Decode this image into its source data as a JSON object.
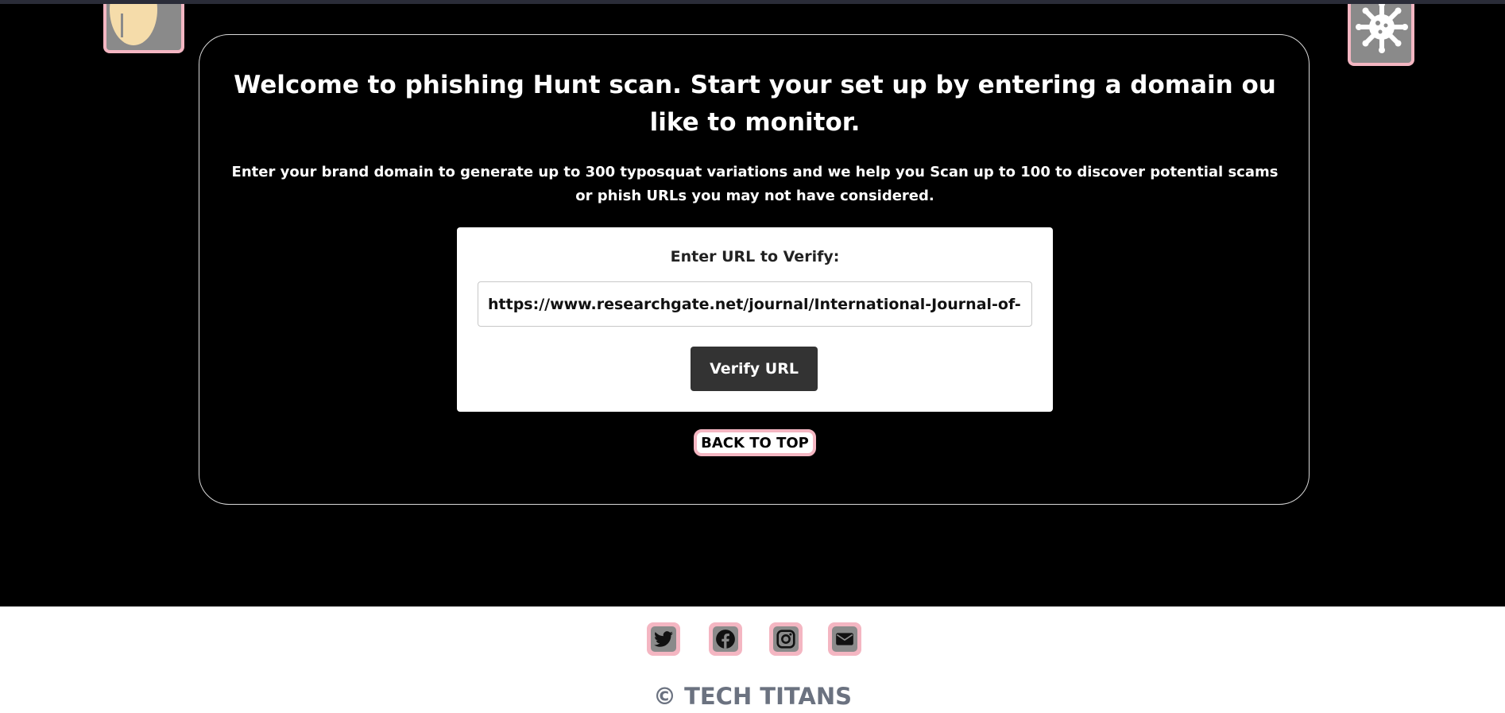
{
  "hero": {
    "title": "Welcome to phishing Hunt scan. Start your set up by entering a domain ou like to monitor.",
    "subtitle": "Enter your brand domain to generate up to 300 typosquat variations and we help you Scan up to 100 to discover potential scams or phish URLs you may not have considered."
  },
  "form": {
    "label": "Enter URL to Verify:",
    "url_value": "https://www.researchgate.net/journal/International-Journal-of-S",
    "button_label": "Verify URL"
  },
  "back_to_top": "BACK TO TOP",
  "decorations": {
    "left_icon": "egg-icon",
    "right_icon": "virus-icon"
  },
  "social": [
    {
      "icon": "twitter-icon"
    },
    {
      "icon": "facebook-icon"
    },
    {
      "icon": "instagram-icon"
    },
    {
      "icon": "envelope-icon"
    }
  ],
  "footer": {
    "copyright": "© TECH TITANS"
  },
  "colors": {
    "accent_pink": "#f4b6c2",
    "button_dark": "#333333",
    "footer_text": "#6b7280"
  }
}
